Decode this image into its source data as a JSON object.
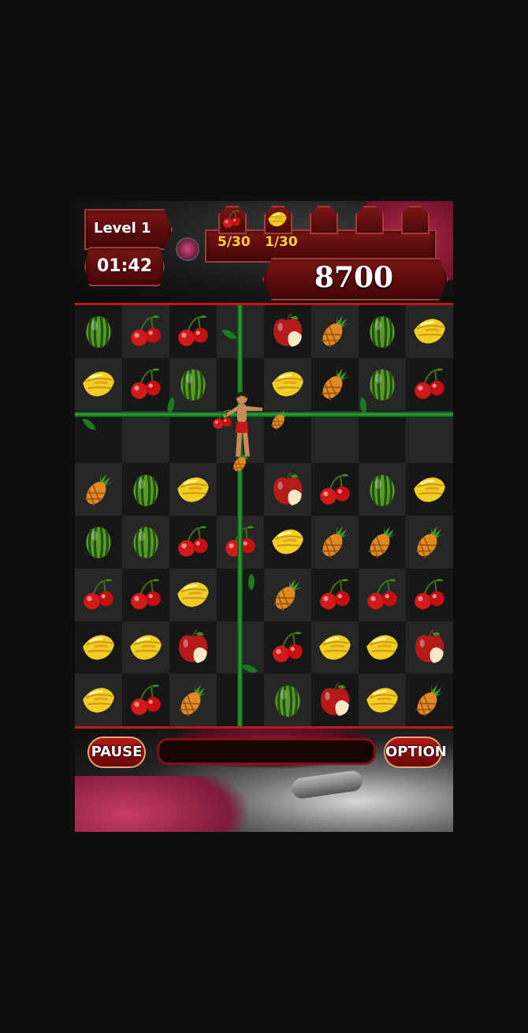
{
  "hud": {
    "level_label": "Level 1",
    "timer": "01:42",
    "score": "8700",
    "goals": [
      {
        "fruit": "cherry",
        "count": "5/30"
      },
      {
        "fruit": "starfruit",
        "count": "1/30"
      },
      {
        "fruit": "empty",
        "count": ""
      },
      {
        "fruit": "empty",
        "count": ""
      },
      {
        "fruit": "empty",
        "count": ""
      }
    ]
  },
  "board": {
    "rows": [
      [
        "watermelon",
        "cherry",
        "cherry",
        "empty",
        "apple",
        "pineapple",
        "watermelon",
        "starfruit"
      ],
      [
        "starfruit",
        "cherry",
        "watermelon",
        "empty",
        "starfruit",
        "pineapple",
        "watermelon",
        "cherry"
      ],
      [
        "empty",
        "empty",
        "empty",
        "empty",
        "empty",
        "empty",
        "empty",
        "empty"
      ],
      [
        "pineapple",
        "watermelon",
        "starfruit",
        "empty",
        "apple",
        "cherry",
        "watermelon",
        "starfruit"
      ],
      [
        "watermelon",
        "watermelon",
        "cherry",
        "cherry",
        "starfruit",
        "pineapple",
        "pineapple",
        "pineapple"
      ],
      [
        "cherry",
        "cherry",
        "starfruit",
        "empty",
        "pineapple",
        "cherry",
        "cherry",
        "cherry"
      ],
      [
        "starfruit",
        "starfruit",
        "apple",
        "empty",
        "cherry",
        "starfruit",
        "starfruit",
        "apple"
      ],
      [
        "starfruit",
        "cherry",
        "pineapple",
        "empty",
        "watermelon",
        "apple",
        "starfruit",
        "pineapple"
      ]
    ],
    "falling": [
      "cherry",
      "pineapple",
      "pineapple"
    ]
  },
  "controls": {
    "pause_label": "PAUSE",
    "option_label": "OPTION",
    "progress": 0.0
  },
  "colors": {
    "accent": "#c41818",
    "goal_text": "#ffd23a"
  }
}
